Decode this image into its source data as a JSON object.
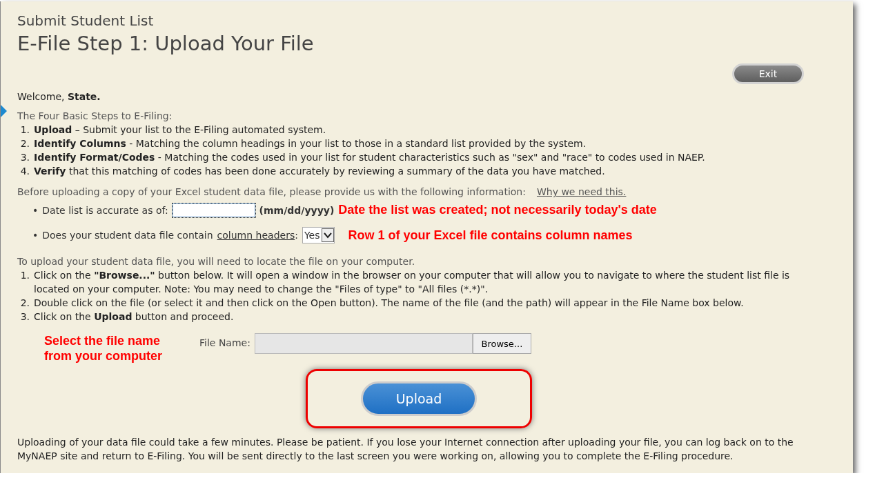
{
  "header": {
    "subtitle": "Submit Student List",
    "title": "E-File Step 1: Upload Your File",
    "exit_button": "Exit"
  },
  "welcome": {
    "prefix": "Welcome,",
    "name": "State."
  },
  "steps": {
    "intro": "The Four Basic Steps to E-Filing:",
    "items": [
      {
        "number": "1.",
        "text": "**Upload** – Submit your list to the E-Filing automated system."
      },
      {
        "number": "2.",
        "text": "**Identify Columns** - Matching the column headings in your list to those in a standard list provided by the system."
      },
      {
        "number": "3.",
        "text": "**Identify Format/Codes** - Matching the codes used in your list for student characteristics such as \"sex\" and \"race\" to codes used in NAEP."
      },
      {
        "number": "4.",
        "text": "**Verify** that this matching of codes has been done accurately by reviewing a summary of the data you have matched."
      }
    ]
  },
  "info": {
    "intro": "Before uploading a copy of your Excel student data file, please provide us with the following information:",
    "link": "Why we need this.",
    "date_question": {
      "bullet": "•",
      "label": "Date list is accurate as of:",
      "format": "(mm/dd/yyyy)",
      "note": "Date the list was created; not necessarily today's date"
    },
    "headers_question": {
      "bullet": "•",
      "label_before": "Does your student data file contain",
      "link": "column headers",
      "label_after": ":",
      "value": "Yes",
      "note": "Row 1 of your Excel file contains column names"
    }
  },
  "upload_steps": {
    "intro": "To upload your student data file, you will need to locate the file on your computer.",
    "items": [
      {
        "number": "1.",
        "parts": [
          {
            "text": "Click on the ",
            "bold": false
          },
          {
            "text": "\"Browse...\"",
            "bold": true
          },
          {
            "text": " button below. It will open a window in the browser on your computer that will allow you to navigate to where the student list file is located on your computer. Note: You may need to change the \"Files of type\" to \"All files (*.*)\".",
            "bold": false
          }
        ]
      },
      {
        "number": "2.",
        "parts": [
          {
            "text": "Double click on the file (or select it and then click on the Open button). The name of the file (and the path) will appear in the File Name box below.",
            "bold": false
          }
        ]
      },
      {
        "number": "3.",
        "parts": [
          {
            "text": "Click on the ",
            "bold": false
          },
          {
            "text": "Upload",
            "bold": true
          },
          {
            "text": " button and proceed.",
            "bold": false
          }
        ]
      }
    ]
  },
  "file_picker": {
    "note": "Select the file name from your computer",
    "label": "File Name:",
    "browse_button": "Browse...",
    "upload_button": "Upload"
  },
  "footer_note": "Uploading of your data file could take a few minutes. Please be patient. If you lose your Internet connection after uploading your file, you can log back on to the MyNAEP site and return to E-Filing. You will be sent directly to the last screen you were working on, allowing you to complete the E-Filing procedure."
}
